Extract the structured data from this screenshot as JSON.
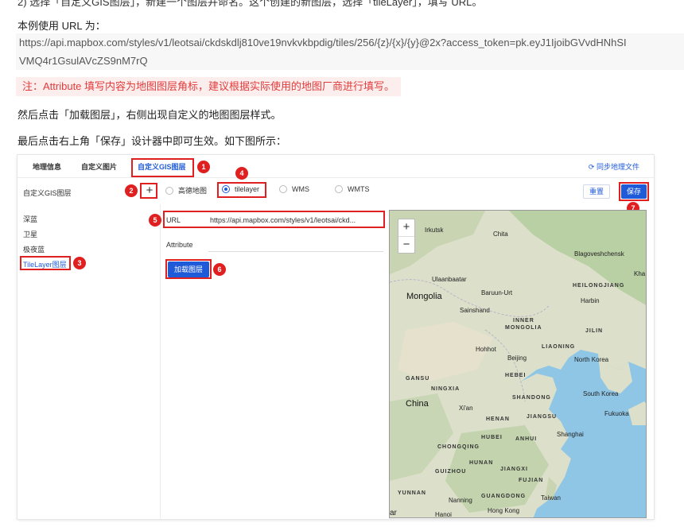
{
  "doc": {
    "cut_line": "2) 选择「自定义GIS图层」，新建一个图层并命名。这个创建的新图层，选择「tileLayer」，填写 URL。",
    "intro": "本例使用 URL 为：",
    "url_line1": "https://api.mapbox.com/styles/v1/leotsai/ckdskdlj810ve19nvkvkbpdig/tiles/256/{z}/{x}/{y}@2x?access_token=pk.eyJ1IjoibGVvdHNhSI",
    "url_line2": "VMQ4r1GsulAVcZS9nM7rQ",
    "note": "注：Attribute 填写内容为地图图层角标，建议根据实际使用的地图厂商进行填写。",
    "step_load": "然后点击「加载图层」，右侧出现自定义的地图图层样式。",
    "step_save": "最后点击右上角「保存」设计器中即可生效。如下图所示："
  },
  "screenshot": {
    "tabs": [
      "地理信息",
      "自定义图片",
      "自定义GIS图层"
    ],
    "active_tab": "自定义GIS图层",
    "sync_label": "同步地理文件",
    "toolbar_label": "自定义GIS图层",
    "add_symbol": "+",
    "radio_options": [
      "高德地图",
      "tilelayer",
      "WMS",
      "WMTS"
    ],
    "radio_selected": "tilelayer",
    "reset_label": "重置",
    "save_label": "保存",
    "layers": [
      "深蓝",
      "卫星",
      "极夜蓝",
      "TileLayer图层"
    ],
    "url_label": "URL",
    "url_value": "https://api.mapbox.com/styles/v1/leotsai/ckd...",
    "attribute_label": "Attribute",
    "load_label": "加载图层",
    "badges": [
      "1",
      "2",
      "3",
      "4",
      "5",
      "6",
      "7"
    ]
  },
  "map": {
    "zoom_in": "+",
    "zoom_out": "−",
    "labels": {
      "irkutsk": "Irkutsk",
      "chita": "Chita",
      "blagoveshchensk": "Blagoveshchensk",
      "kha": "Kha",
      "ulaanbaatar": "Ulaanbaatar",
      "baruun_urt": "Baruun-Urt",
      "heilongjiang": "HEILONGJIANG",
      "mongolia": "Mongolia",
      "harbin": "Harbin",
      "sainshand": "Sainshand",
      "inner": "INNER",
      "mongolia_prov": "MONGOLIA",
      "jilin": "JILIN",
      "hohhot": "Hohhot",
      "liaoning": "LIAONING",
      "beijing": "Beijing",
      "north_korea": "North Korea",
      "hebei": "HEBEI",
      "gansu": "GANSU",
      "ningxia": "NINGXIA",
      "south_korea": "South Korea",
      "shandong": "SHANDONG",
      "china": "China",
      "xian": "Xi'an",
      "fukuoka": "Fukuoka",
      "henan": "HENAN",
      "jiangsu": "JIANGSU",
      "shanghai": "Shanghai",
      "hubei": "HUBEI",
      "anhui": "ANHUI",
      "chongqing": "CHONGQING",
      "hunan": "HUNAN",
      "jiangxi": "JIANGXI",
      "guizhou": "GUIZHOU",
      "fujian": "FUJIAN",
      "yunnan": "YUNNAN",
      "nanning": "Nanning",
      "guangdong": "GUANGDONG",
      "taiwan": "Taiwan",
      "hong_kong": "Hong Kong",
      "hanoi": "Hanoi",
      "ar": "ar"
    }
  },
  "colors": {
    "accent": "#1f5bd8",
    "annotation": "#e02020",
    "note_bg": "#fdeeee",
    "sea": "#8fc6e6",
    "land": "#d8ddc6"
  }
}
